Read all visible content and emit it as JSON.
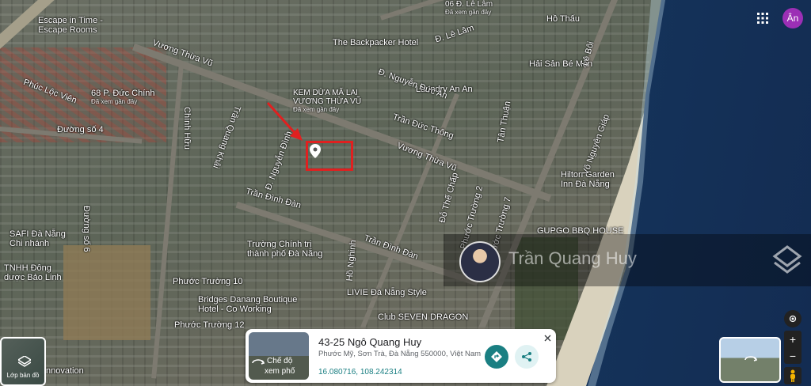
{
  "map": {
    "places": [
      {
        "name": "Escape in Time -",
        "sub": "Escape Rooms"
      },
      {
        "name": "68 P. Đức Chính",
        "sub": "Đã xem gần đây"
      },
      {
        "name": "KEM DỪA MÃ LAI",
        "sub": "VƯƠNG THỪA VŨ"
      },
      {
        "name": "Đã xem gần đây",
        "sub": ""
      },
      {
        "name": "The Backpacker Hotel",
        "sub": ""
      },
      {
        "name": "Laundry An An",
        "sub": ""
      },
      {
        "name": "Hải Sản Bé Mặn",
        "sub": ""
      },
      {
        "name": "Hilton Garden",
        "sub": "Inn Đà Nẵng"
      },
      {
        "name": "GUPGO BBQ HOUSE",
        "sub": ""
      },
      {
        "name": "SAFI Đà Nẵng",
        "sub": "Chi nhánh"
      },
      {
        "name": "TNHH Đông",
        "sub": "dược Bảo Linh"
      },
      {
        "name": "Trường Chính trị",
        "sub": "thành phố Đà Nẵng"
      },
      {
        "name": "Bridges Danang Boutique",
        "sub": "Hotel - Co Working"
      },
      {
        "name": "LIVIE Đà Nẵng Style",
        "sub": ""
      },
      {
        "name": "Club SEVEN DRAGON",
        "sub": ""
      },
      {
        "name": "06 Đ. Lê Lâm",
        "sub": "Đã xem gần đây"
      },
      {
        "name": "nnovation",
        "sub": ""
      }
    ],
    "streets": [
      "Vương Thừa Vũ",
      "Phúc Lộc Viên",
      "Đường số 4",
      "Đường số 6",
      "Chính Hữu",
      "Trần Quang Khải",
      "Đ. Nguyễn Đình",
      "Trần Đình Đàn",
      "Phước Trường 10",
      "Phước Trường 12",
      "Trần Đức Thông",
      "Vương Thừa Vũ",
      "Đỗ Thế Chấp",
      "Phước Trường 2",
      "Phước Trường 7",
      "Võ Nguyên Giáp",
      "Lê Bôi",
      "Hồ Thấu",
      "Đ. Lê Lâm",
      "Đ. Nguyễn Đức An",
      "Tân Thuận",
      "Hồ Nghinh",
      "Trần Đình Đàn"
    ]
  },
  "top_right": {
    "apps_icon": "apps-grid-icon",
    "avatar_letter": "Ân",
    "avatar_color": "#9c2fb5"
  },
  "watermark": {
    "text": "Trần Quang Huy"
  },
  "layer_button": {
    "label": "Lớp bản đồ",
    "icon": "layers-icon"
  },
  "info_card": {
    "title": "43-25 Ngô Quang Huy",
    "address": "Phước Mỹ, Sơn Trà, Đà Nẵng 550000, Việt Nam",
    "coords": "16.080716, 108.242314",
    "streetview_label_1": "Chế độ",
    "streetview_label_2": "xem phố",
    "directions_icon": "directions-icon",
    "share_icon": "share-icon",
    "close_icon": "close-icon"
  },
  "controls": {
    "zoom_in": "+",
    "zoom_out": "−",
    "location_icon": "my-location-icon",
    "pegman_icon": "pegman-icon"
  },
  "colors": {
    "accent": "#1a7f82",
    "marker": "#e02020",
    "sea": "#173a63"
  }
}
